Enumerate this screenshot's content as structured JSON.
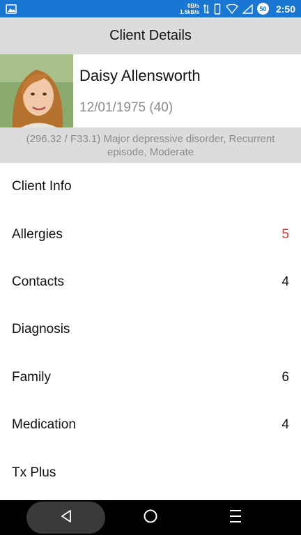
{
  "status_bar": {
    "net_down": "0B/s",
    "net_up": "1.5kB/s",
    "battery_level": "50",
    "time": "2:50",
    "icons": [
      "image-icon",
      "data-arrows-icon",
      "vibrate-icon",
      "wifi-icon",
      "signal-icon",
      "battery-icon"
    ]
  },
  "app_bar": {
    "title": "Client Details"
  },
  "client": {
    "name": "Daisy Allensworth",
    "dob": "12/01/1975 (40)",
    "diagnosis": "(296.32 / F33.1) Major depressive disorder, Recurrent episode, Moderate"
  },
  "menu": [
    {
      "label": "Client Info",
      "count": ""
    },
    {
      "label": "Allergies",
      "count": "5",
      "alert": true
    },
    {
      "label": "Contacts",
      "count": "4"
    },
    {
      "label": "Diagnosis",
      "count": ""
    },
    {
      "label": "Family",
      "count": "6"
    },
    {
      "label": "Medication",
      "count": "4"
    },
    {
      "label": "Tx Plus",
      "count": ""
    }
  ],
  "colors": {
    "status_bar": "#1976d2",
    "app_bar": "#dcdcdc",
    "alert": "#e53935"
  }
}
